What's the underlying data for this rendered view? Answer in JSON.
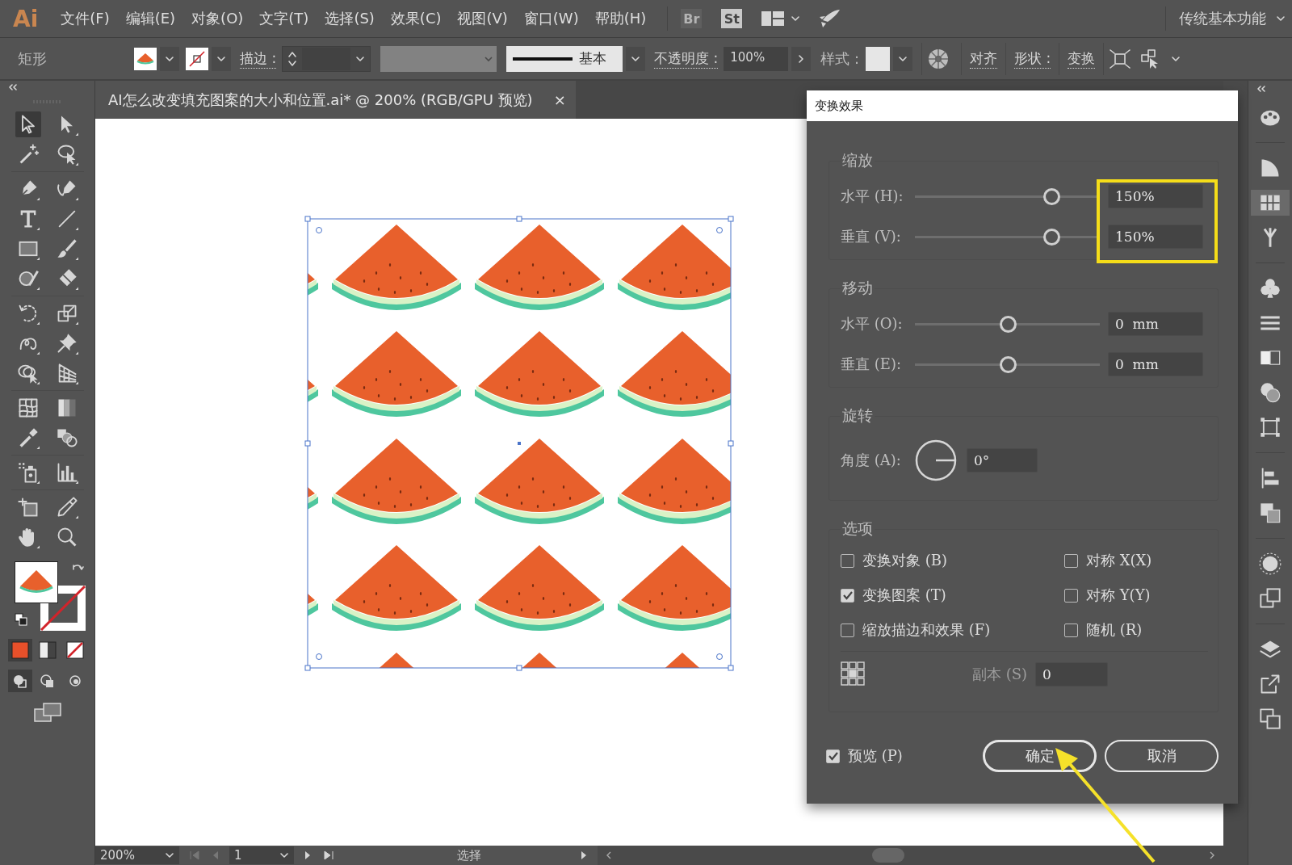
{
  "menu_bar": {
    "logo": "Ai",
    "items": [
      "文件(F)",
      "编辑(E)",
      "对象(O)",
      "文字(T)",
      "选择(S)",
      "效果(C)",
      "视图(V)",
      "窗口(W)",
      "帮助(H)"
    ],
    "apps": [
      {
        "label": "Br",
        "disabled": true
      },
      {
        "label": "St",
        "disabled": false
      }
    ],
    "workspace": "传统基本功能"
  },
  "control_bar": {
    "tool_name": "矩形",
    "stroke_label": "描边 :",
    "stroke_profile": "基本",
    "opacity_label": "不透明度 :",
    "opacity": "100%",
    "style_label": "样式 :",
    "align_link": "对齐",
    "shape_link": "形状 :",
    "transform_link": "变换"
  },
  "document": {
    "tab_title": "AI怎么改变填充图案的大小和位置.ai* @ 200% (RGB/GPU 预览)",
    "close": "×"
  },
  "dialog": {
    "title": "变换效果",
    "scale": {
      "title": "缩放",
      "highlighted": true,
      "rows": [
        {
          "label": "水平 (H):",
          "level": 0.74,
          "value": "150%"
        },
        {
          "label": "垂直 (V):",
          "level": 0.74,
          "value": "150%"
        }
      ]
    },
    "move": {
      "title": "移动",
      "rows": [
        {
          "label": "水平 (O):",
          "level": 0.5,
          "value": "0  mm"
        },
        {
          "label": "垂直 (E):",
          "level": 0.5,
          "value": "0  mm"
        }
      ]
    },
    "rotate": {
      "title": "旋转",
      "label": "角度 (A):",
      "value": "0°"
    },
    "options": {
      "title": "选项",
      "checkboxes": [
        {
          "label": "变换对象 (B)",
          "checked": false
        },
        {
          "label": "对称 X(X)",
          "checked": false
        },
        {
          "label": "变换图案 (T)",
          "checked": true
        },
        {
          "label": "对称 Y(Y)",
          "checked": false
        },
        {
          "label": "缩放描边和效果 (F)",
          "checked": false
        },
        {
          "label": "随机 (R)",
          "checked": false
        }
      ],
      "copies_label": "副本 (S)",
      "copies_value": "0"
    },
    "preview": {
      "label": "预览 (P)",
      "checked": true
    },
    "buttons": [
      {
        "label": "确定",
        "default": true,
        "pointed_at": true
      },
      {
        "label": "取消",
        "default": false,
        "pointed_at": false
      }
    ]
  },
  "status_bar": {
    "zoom": "200%",
    "page": "1",
    "tool": "选择"
  }
}
